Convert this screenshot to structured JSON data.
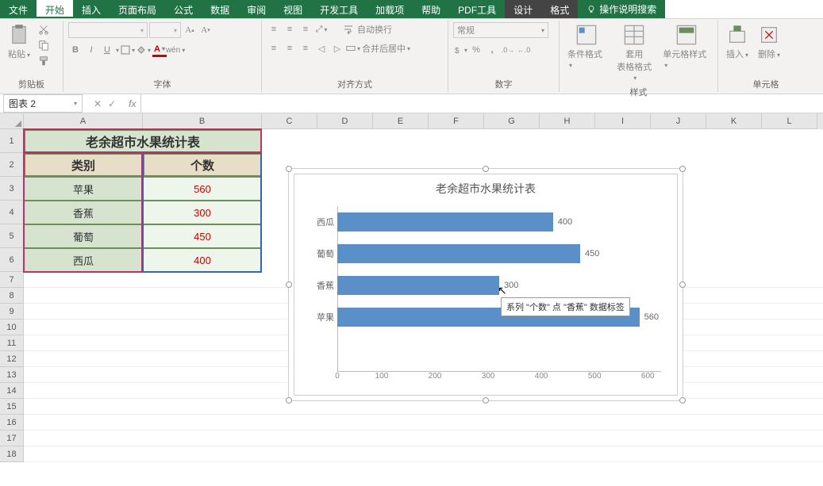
{
  "tabs": {
    "file": "文件",
    "home": "开始",
    "insert": "插入",
    "pagelayout": "页面布局",
    "formulas": "公式",
    "data": "数据",
    "review": "审阅",
    "view": "视图",
    "devtools": "开发工具",
    "addins": "加载项",
    "help": "帮助",
    "pdf": "PDF工具",
    "design": "设计",
    "format": "格式",
    "query": "操作说明搜索"
  },
  "ribbon": {
    "clipboard": {
      "label": "剪贴板",
      "paste": "粘贴"
    },
    "font": {
      "label": "字体"
    },
    "align": {
      "label": "对齐方式",
      "wrap": "自动换行",
      "merge": "合并后居中"
    },
    "number": {
      "label": "数字",
      "general": "常规"
    },
    "styles": {
      "label": "样式",
      "cond": "条件格式",
      "tbl": "套用\n表格格式",
      "cell": "单元格样式"
    },
    "cells": {
      "label": "单元格",
      "insert": "插入",
      "delete": "删除"
    }
  },
  "namebox": "图表 2",
  "colheaders": [
    "A",
    "B",
    "C",
    "D",
    "E",
    "F",
    "G",
    "H",
    "I",
    "J",
    "K",
    "L"
  ],
  "table": {
    "title": "老余超市水果统计表",
    "h1": "类别",
    "h2": "个数",
    "rows": [
      {
        "cat": "苹果",
        "val": "560"
      },
      {
        "cat": "香蕉",
        "val": "300"
      },
      {
        "cat": "葡萄",
        "val": "450"
      },
      {
        "cat": "西瓜",
        "val": "400"
      }
    ]
  },
  "chart_data": {
    "type": "bar",
    "title": "老余超市水果统计表",
    "categories": [
      "西瓜",
      "葡萄",
      "香蕉",
      "苹果"
    ],
    "values": [
      400,
      450,
      300,
      560
    ],
    "xlabel": "",
    "ylabel": "",
    "xlim": [
      0,
      600
    ],
    "xticks": [
      0,
      100,
      200,
      300,
      400,
      500,
      600
    ]
  },
  "tooltip": "系列 \"个数\" 点 \"香蕉\" 数据标签"
}
